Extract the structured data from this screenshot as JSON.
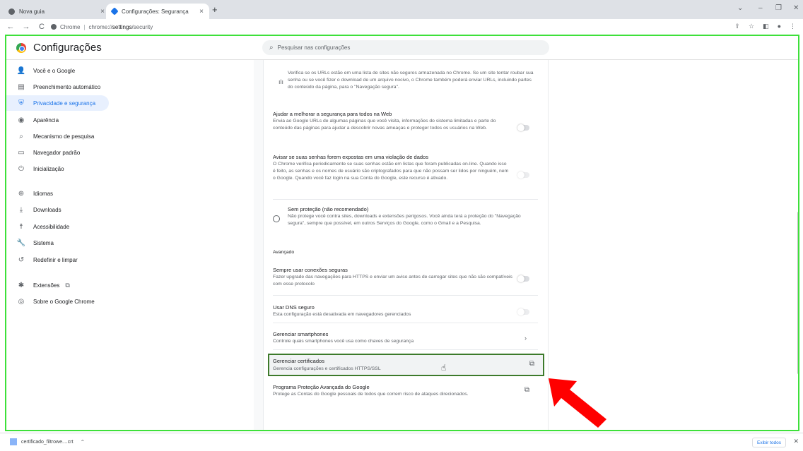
{
  "tabs": [
    {
      "title": "Nova guia",
      "close": "×"
    },
    {
      "title": "Configurações: Segurança",
      "close": "×"
    }
  ],
  "new_tab": "+",
  "window_controls": {
    "dropdown": "⌄",
    "minimize": "–",
    "restore": "❐",
    "close": "✕"
  },
  "toolbar": {
    "back": "←",
    "forward": "→",
    "reload": "C",
    "site_label": "Chrome",
    "url_prefix": "chrome://",
    "url_path": "settings",
    "url_suffix": "/security"
  },
  "header": {
    "title": "Configurações",
    "search_placeholder": "Pesquisar nas configurações"
  },
  "sidebar": {
    "items": [
      {
        "label": "Você e o Google",
        "icon": "person-icon"
      },
      {
        "label": "Preenchimento automático",
        "icon": "clipboard-icon"
      },
      {
        "label": "Privacidade e segurança",
        "icon": "shield-icon",
        "active": true
      },
      {
        "label": "Aparência",
        "icon": "palette-icon"
      },
      {
        "label": "Mecanismo de pesquisa",
        "icon": "search-icon"
      },
      {
        "label": "Navegador padrão",
        "icon": "browser-icon"
      },
      {
        "label": "Inicialização",
        "icon": "power-icon"
      },
      {
        "label": "Idiomas",
        "icon": "globe-icon"
      },
      {
        "label": "Downloads",
        "icon": "download-icon"
      },
      {
        "label": "Acessibilidade",
        "icon": "accessibility-icon"
      },
      {
        "label": "Sistema",
        "icon": "wrench-icon"
      },
      {
        "label": "Redefinir e limpar",
        "icon": "restore-icon"
      },
      {
        "label": "Extensões",
        "icon": "puzzle-icon"
      },
      {
        "label": "Sobre o Google Chrome",
        "icon": "chrome-icon"
      }
    ]
  },
  "main": {
    "safe_browsing_desc": "Verifica se os URLs estão em uma lista de sites não seguros armazenada no Chrome. Se um site tentar roubar sua senha ou se você fizer o download de um arquivo nocivo, o Chrome também poderá enviar URLs, incluindo partes do conteúdo da página, para o \"Navegação segura\".",
    "help_improve_title": "Ajudar a melhorar a segurança para todos na Web",
    "help_improve_desc": "Envia ao Google URLs de algumas páginas que você visita, informações do sistema limitadas e parte do conteúdo das páginas para ajudar a descobrir novas ameaças e proteger todos os usuários na Web.",
    "password_warn_title": "Avisar se suas senhas forem expostas em uma violação de dados",
    "password_warn_desc": "O Chrome verifica periodicamente se suas senhas estão em listas que foram publicadas on-line. Quando isso é feito, as senhas e os nomes de usuário são criptografados para que não possam ser lidos por ninguém, nem o Google. Quando você faz login na sua Conta do Google, este recurso é ativado.",
    "no_protection_title": "Sem proteção (não recomendado)",
    "no_protection_desc": "Não protege você contra sites, downloads e extensões perigosos. Você ainda terá a proteção do \"Navegação segura\", sempre que possível, em outros Serviços do Google, como o Gmail e a Pesquisa.",
    "advanced_label": "Avançado",
    "https_title": "Sempre usar conexões seguras",
    "https_desc": "Fazer upgrade das navegações para HTTPS e enviar um aviso antes de carregar sites que não são compatíveis com esse protocolo",
    "dns_title": "Usar DNS seguro",
    "dns_desc": "Esta configuração está desativada em navegadores gerenciados",
    "phones_title": "Gerenciar smartphones",
    "phones_desc": "Controle quais smartphones você usa como chaves de segurança",
    "certs_title": "Gerenciar certificados",
    "certs_desc": "Gerencia configurações e certificados HTTPS/SSL",
    "advanced_protection_title": "Programa Proteção Avançada do Google",
    "advanced_protection_desc": "Protege as Contas do Google pessoais de todos que correm risco de ataques direcionados."
  },
  "downloads_bar": {
    "file_name": "certificado_filtrowe....crt",
    "show_all": "Exibir todos",
    "close": "✕"
  },
  "colors": {
    "accent": "#1a73e8",
    "highlight_green": "#3ee03a",
    "box_green": "#3d7a2b",
    "arrow_red": "#ff0000"
  }
}
